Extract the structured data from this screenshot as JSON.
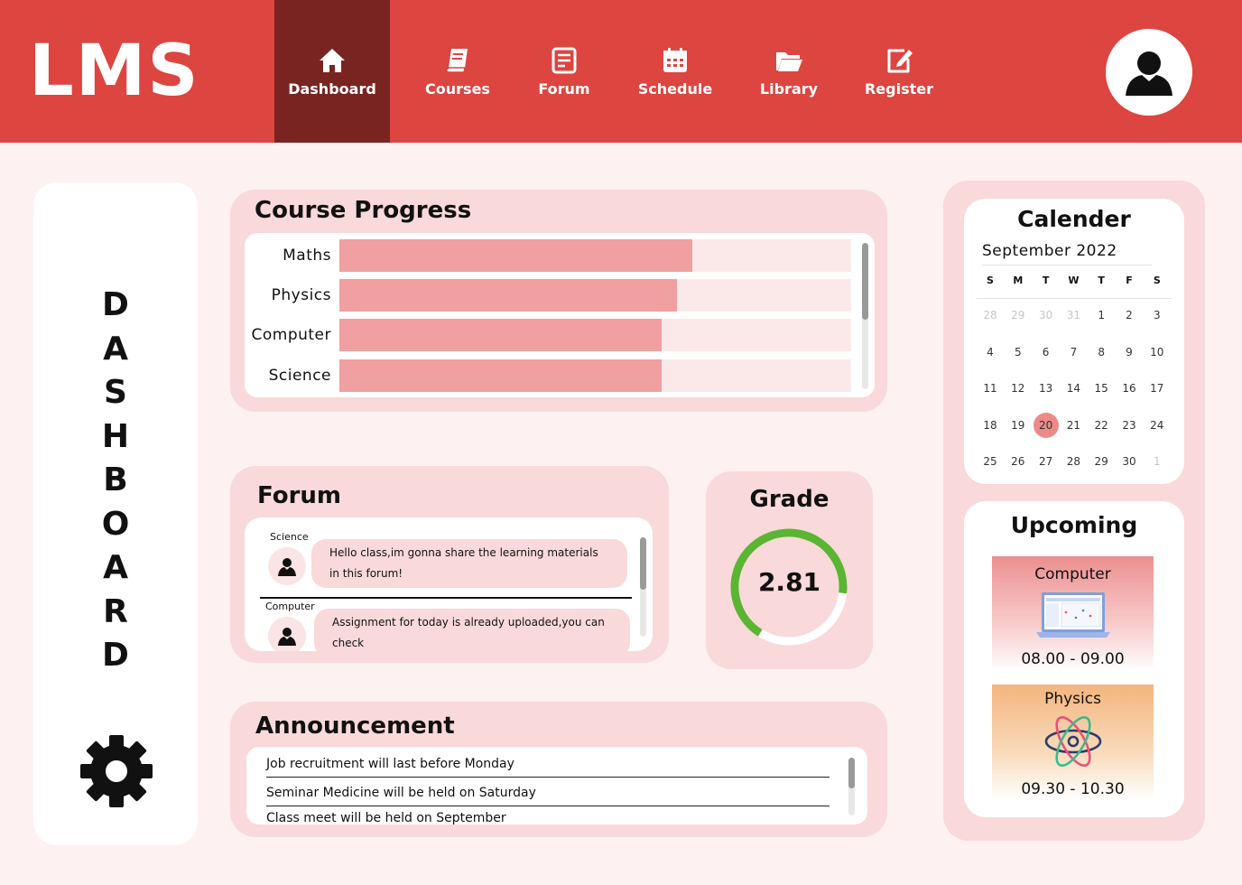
{
  "header": {
    "logo": "LMS",
    "nav": [
      {
        "label": "Dashboard",
        "icon": "home-icon",
        "active": true
      },
      {
        "label": "Courses",
        "icon": "book-icon",
        "active": false
      },
      {
        "label": "Forum",
        "icon": "note-icon",
        "active": false
      },
      {
        "label": "Schedule",
        "icon": "calendar-icon",
        "active": false
      },
      {
        "label": "Library",
        "icon": "folder-icon",
        "active": false
      },
      {
        "label": "Register",
        "icon": "edit-icon",
        "active": false
      }
    ],
    "avatar_icon": "user-icon"
  },
  "sidebar": {
    "title": "DASHBOARD",
    "settings_icon": "gear-icon"
  },
  "course_progress": {
    "title": "Course Progress",
    "courses": [
      {
        "name": "Maths",
        "progress": 0.69
      },
      {
        "name": "Physics",
        "progress": 0.66
      },
      {
        "name": "Computer",
        "progress": 0.63
      },
      {
        "name": "Science",
        "progress": 0.63
      }
    ]
  },
  "forum": {
    "title": "Forum",
    "posts": [
      {
        "course": "Science",
        "message": "Hello class,im gonna share the learning materials in this forum!"
      },
      {
        "course": "Computer",
        "message": "Assignment for today is already uploaded,you can check"
      }
    ]
  },
  "grade": {
    "title": "Grade",
    "value": "2.81",
    "fraction": 0.7,
    "color": "#5ab532"
  },
  "announcement": {
    "title": "Announcement",
    "items": [
      "Job recruitment will last before Monday",
      "Seminar Medicine will be held on Saturday",
      "Class meet will be held on September"
    ]
  },
  "calendar": {
    "title": "Calender",
    "month": "September 2022",
    "weekdays": [
      "S",
      "M",
      "T",
      "W",
      "T",
      "F",
      "S"
    ],
    "weeks": [
      [
        {
          "d": "28",
          "m": true
        },
        {
          "d": "29",
          "m": true
        },
        {
          "d": "30",
          "m": true
        },
        {
          "d": "31",
          "m": true
        },
        {
          "d": "1"
        },
        {
          "d": "2"
        },
        {
          "d": "3"
        }
      ],
      [
        {
          "d": "4"
        },
        {
          "d": "5"
        },
        {
          "d": "6"
        },
        {
          "d": "7"
        },
        {
          "d": "8"
        },
        {
          "d": "9"
        },
        {
          "d": "10"
        }
      ],
      [
        {
          "d": "11"
        },
        {
          "d": "12"
        },
        {
          "d": "13"
        },
        {
          "d": "14"
        },
        {
          "d": "15"
        },
        {
          "d": "16"
        },
        {
          "d": "17"
        }
      ],
      [
        {
          "d": "18"
        },
        {
          "d": "19"
        },
        {
          "d": "20",
          "today": true
        },
        {
          "d": "21"
        },
        {
          "d": "22"
        },
        {
          "d": "23"
        },
        {
          "d": "24"
        }
      ],
      [
        {
          "d": "25"
        },
        {
          "d": "26"
        },
        {
          "d": "27"
        },
        {
          "d": "28"
        },
        {
          "d": "29"
        },
        {
          "d": "30"
        },
        {
          "d": "1",
          "m": true
        }
      ]
    ]
  },
  "upcoming": {
    "title": "Upcoming",
    "items": [
      {
        "course": "Computer",
        "time": "08.00 - 09.00",
        "icon": "laptop-icon"
      },
      {
        "course": "Physics",
        "time": "09.30 - 10.30",
        "icon": "atom-icon"
      }
    ]
  },
  "colors": {
    "header": "#dd4540",
    "active_nav": "#7a2422",
    "card": "#f9d9d9",
    "progress_fill": "#f0a0a0",
    "today": "#ec8a8a"
  }
}
